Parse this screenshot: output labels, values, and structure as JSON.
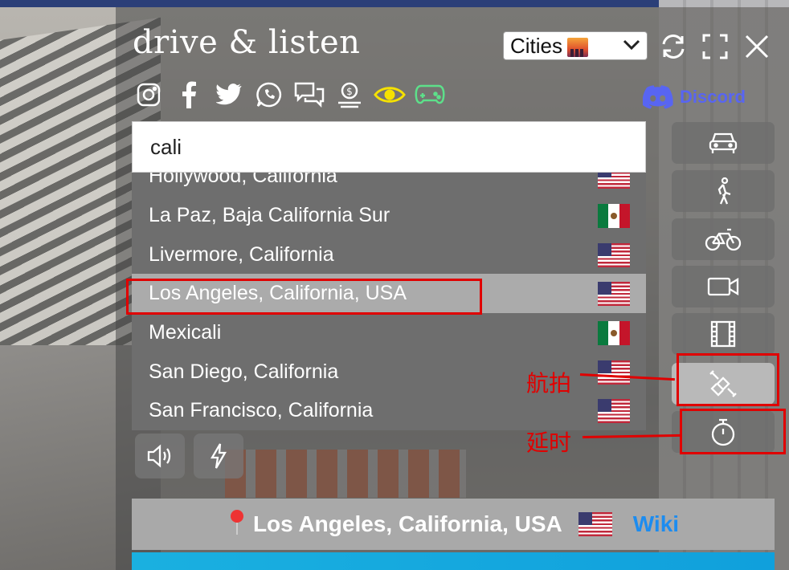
{
  "app": {
    "logo": "drive & listen"
  },
  "category_select": {
    "value": "Cities"
  },
  "top_icons": [
    "refresh-icon",
    "fullscreen-icon",
    "close-icon"
  ],
  "social_icons": [
    "instagram-icon",
    "facebook-icon",
    "twitter-icon",
    "whatsapp-icon",
    "chat-icon",
    "donate-icon",
    "eye-icon",
    "gamepad-icon"
  ],
  "discord": {
    "label": "Discord"
  },
  "search": {
    "value": "cali"
  },
  "results": [
    {
      "label": "Hollywood, California",
      "flag": "us"
    },
    {
      "label": "La Paz, Baja California Sur",
      "flag": "mx"
    },
    {
      "label": "Livermore, California",
      "flag": "us"
    },
    {
      "label": "Los Angeles, California, USA",
      "flag": "us",
      "selected": true
    },
    {
      "label": "Mexicali",
      "flag": "mx"
    },
    {
      "label": "San Diego, California",
      "flag": "us"
    },
    {
      "label": "San Francisco, California",
      "flag": "us"
    }
  ],
  "controls": [
    "volume-icon",
    "lightning-icon"
  ],
  "modes": [
    "car-icon",
    "walk-icon",
    "bike-icon",
    "video-camera-icon",
    "film-icon",
    "satellite-icon",
    "timer-icon"
  ],
  "annotations": {
    "aerial": "航拍",
    "timelapse": "延时"
  },
  "footer": {
    "location": "Los Angeles, California, USA",
    "wiki": "Wiki"
  },
  "colors": {
    "accent_red": "#e00000",
    "discord": "#5865f2",
    "wiki": "#1c8cf0",
    "eye": "#f5e100",
    "gamepad": "#5de08a"
  }
}
